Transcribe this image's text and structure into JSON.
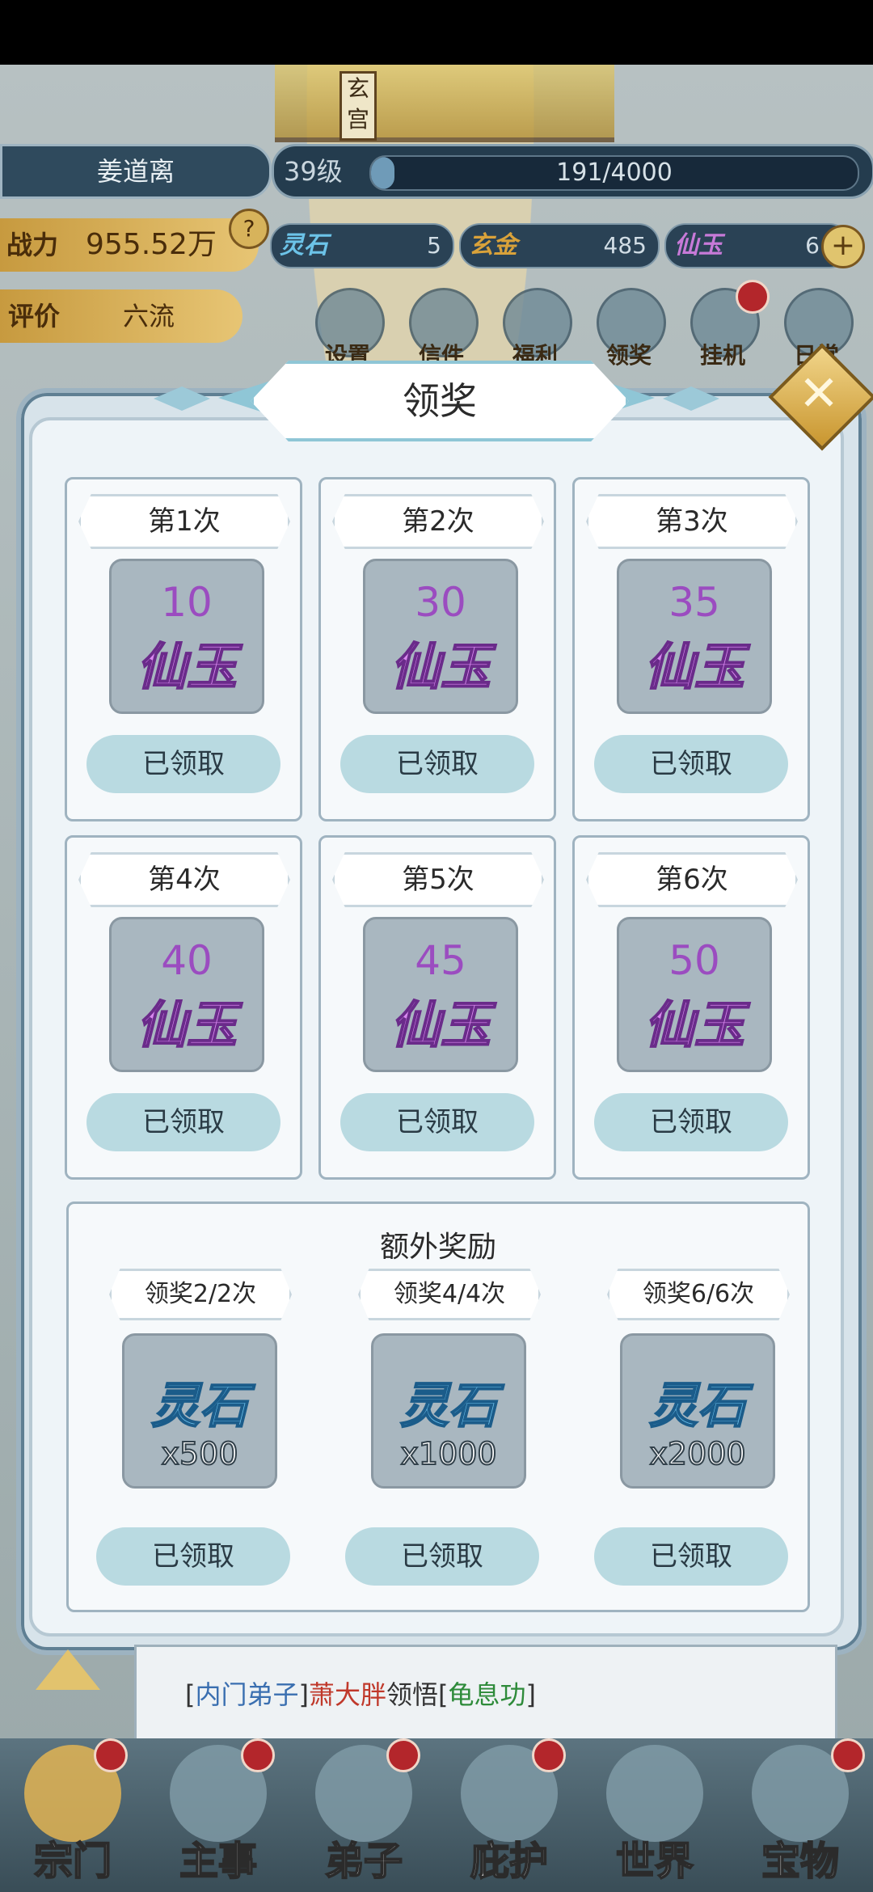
{
  "top": {
    "name": "姜道离",
    "level": "39级",
    "xp_text": "191/4000",
    "xp_fraction": 0.048,
    "power_label": "战力",
    "power_value": "955.52万",
    "help": "?",
    "rating_label": "评价",
    "rating_value": "六流",
    "resources": [
      {
        "label": "灵石",
        "value": "5",
        "color": "#6cc3e8"
      },
      {
        "label": "玄金",
        "value": "485",
        "color": "#d9a23a"
      },
      {
        "label": "仙玉",
        "value": "6",
        "color": "#c77ad8"
      }
    ],
    "plus": "+",
    "temple_sign": "玄宫",
    "menu": [
      "设置",
      "信件",
      "福利",
      "领奖",
      "挂机",
      "日常"
    ]
  },
  "dialog": {
    "title": "领奖",
    "close": "✕",
    "rewards": [
      {
        "tag": "第1次",
        "amount": "10",
        "item": "仙玉",
        "status": "已领取"
      },
      {
        "tag": "第2次",
        "amount": "30",
        "item": "仙玉",
        "status": "已领取"
      },
      {
        "tag": "第3次",
        "amount": "35",
        "item": "仙玉",
        "status": "已领取"
      },
      {
        "tag": "第4次",
        "amount": "40",
        "item": "仙玉",
        "status": "已领取"
      },
      {
        "tag": "第5次",
        "amount": "45",
        "item": "仙玉",
        "status": "已领取"
      },
      {
        "tag": "第6次",
        "amount": "50",
        "item": "仙玉",
        "status": "已领取"
      }
    ],
    "bonus": {
      "title": "额外奖励",
      "items": [
        {
          "tag": "领奖2/2次",
          "item": "灵石",
          "qty": "x500",
          "status": "已领取"
        },
        {
          "tag": "领奖4/4次",
          "item": "灵石",
          "qty": "x1000",
          "status": "已领取"
        },
        {
          "tag": "领奖6/6次",
          "item": "灵石",
          "qty": "x2000",
          "status": "已领取"
        }
      ]
    }
  },
  "chat": {
    "bracket_open": "[",
    "rank": "内门弟子",
    "bracket_close": "]",
    "person": "萧大胖",
    "verb": "领悟",
    "skill": "龟息功",
    "colors": {
      "rank": "#3a6fb0",
      "person": "#c0392b",
      "skill": "#2e8b3a"
    }
  },
  "nav": [
    "宗门",
    "主事",
    "弟子",
    "庇护",
    "世界",
    "宝物"
  ]
}
